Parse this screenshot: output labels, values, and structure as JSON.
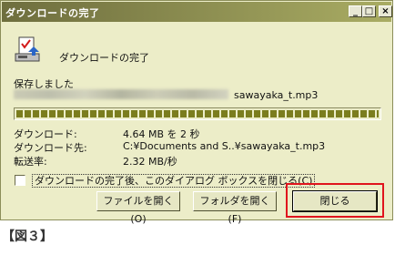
{
  "window": {
    "title": "ダウンロードの完了",
    "buttons": {
      "minimize": "_",
      "maximize": "□",
      "close": "×"
    }
  },
  "dialog": {
    "heading": "ダウンロードの完了",
    "saved_label": "保存しました",
    "filename": "sawayaka_t.mp3",
    "progress_fraction": 1.0,
    "details": [
      {
        "key": "ダウンロード:",
        "value": "4.64 MB を 2 秒"
      },
      {
        "key": "ダウンロード先:",
        "value": "C:¥Documents and S..¥sawayaka_t.mp3"
      },
      {
        "key": "転送率:",
        "value": "2.32 MB/秒"
      }
    ],
    "close_on_complete_label": "ダウンロードの完了後、このダイアログ ボックスを閉じる(C)",
    "close_on_complete_checked": false
  },
  "buttons": {
    "open_file": "ファイルを開く(O)",
    "open_folder": "フォルダを開く(F)",
    "close": "閉じる"
  },
  "caption": "【図３】",
  "colors": {
    "highlight": "#e0141e",
    "window_bg": "#ecedc8",
    "progress": "#7b7d1e"
  }
}
